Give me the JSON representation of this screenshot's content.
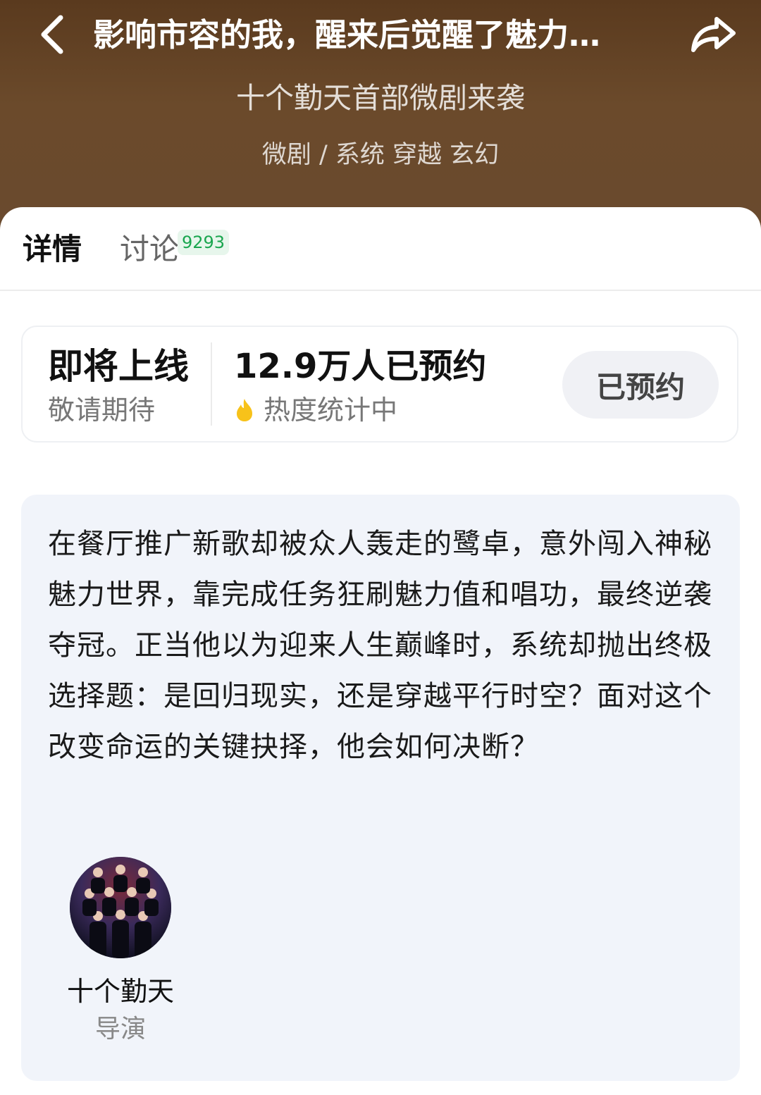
{
  "header": {
    "title": "影响市容的我，醒来后觉醒了魅力…",
    "subtitle": "十个勤天首部微剧来袭",
    "tags": "微剧 / 系统 穿越 玄幻",
    "back_icon": "chevron-left-icon",
    "share_icon": "share-arrow-icon"
  },
  "tabs": [
    {
      "label": "详情",
      "active": true
    },
    {
      "label": "讨论",
      "badge": "9293",
      "active": false
    }
  ],
  "status": {
    "main": "即将上线",
    "sub": "敬请期待",
    "reserve_count": "12.9万人已预约",
    "heat_text": "热度统计中",
    "heat_icon": "flame-icon",
    "reserve_button": "已预约"
  },
  "synopsis": "在餐厅推广新歌却被众人轰走的鹭卓，意外闯入神秘魅力世界，靠完成任务狂刷魅力值和唱功，最终逆袭夺冠。正当他以为迎来人生巅峰时，系统却抛出终极选择题：是回归现实，还是穿越平行时空？面对这个改变命运的关键抉择，他会如何决断？",
  "crew": [
    {
      "name": "十个勤天",
      "role": "导演"
    }
  ],
  "colors": {
    "hero_bg": "#5a3a1e",
    "badge_green": "#1aa64f",
    "flame_yellow": "#f7c21a",
    "synopsis_bg": "#f1f4fa"
  }
}
